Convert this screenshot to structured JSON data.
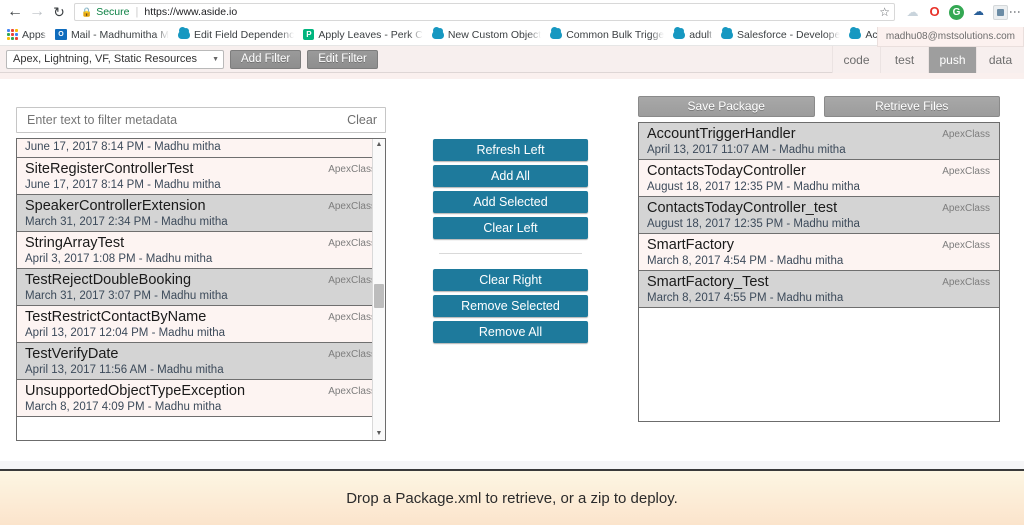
{
  "browser": {
    "back_icon": "back-arrow-icon",
    "forward_icon": "forward-arrow-icon",
    "reload_icon": "reload-icon",
    "security_label": "Secure",
    "url": "https://www.aside.io",
    "bookmark_star": "☆",
    "menu_icon": "kebab-menu-icon",
    "extensions": [
      {
        "name": "cloud-extension-icon",
        "glyph": "☁"
      },
      {
        "name": "opera-extension-icon",
        "glyph": "O"
      },
      {
        "name": "grammarly-extension-icon",
        "glyph": "G"
      },
      {
        "name": "blue-extension-icon",
        "glyph": "☁"
      },
      {
        "name": "square-extension-icon",
        "glyph": ""
      }
    ],
    "bookmarks": [
      {
        "label": "Apps",
        "icon": "apps-grid-icon"
      },
      {
        "label": "Mail - Madhumitha M",
        "icon": "outlook-icon"
      },
      {
        "label": "Edit Field Dependenc",
        "icon": "salesforce-cloud-icon"
      },
      {
        "label": "Apply Leaves - Perk C",
        "icon": "perk-icon"
      },
      {
        "label": "New Custom Object",
        "icon": "salesforce-cloud-icon"
      },
      {
        "label": "Common Bulk Trigge",
        "icon": "salesforce-cloud-icon"
      },
      {
        "label": "adult",
        "icon": "salesforce-cloud-icon"
      },
      {
        "label": "Salesforce - Develope",
        "icon": "salesforce-cloud-icon"
      },
      {
        "label": "Account Fields – Sale",
        "icon": "salesforce-cloud-icon"
      },
      {
        "label": "",
        "icon": "salesforce-cloud-icon"
      },
      {
        "label": "",
        "icon": "salesforce-cloud-icon"
      }
    ],
    "bookmarks_overflow": "»"
  },
  "toolbar": {
    "metadata_filter_value": "Apex, Lightning, VF, Static Resources",
    "caret_icon": "chevron-down-icon",
    "add_filter_label": "Add Filter",
    "edit_filter_label": "Edit Filter",
    "tabs": [
      {
        "label": "code",
        "active": false
      },
      {
        "label": "test",
        "active": false
      },
      {
        "label": "push",
        "active": true
      },
      {
        "label": "data",
        "active": false
      }
    ],
    "user_email": "madhu08@mstsolutions.com"
  },
  "left_panel": {
    "filter_placeholder": "Enter text to filter metadata",
    "filter_value": "",
    "clear_label": "Clear",
    "scroll_up_icon": "▲",
    "scroll_down_icon": "▼",
    "items": [
      {
        "name": "",
        "sub": "June 17, 2017 8:14 PM - Madhu mitha",
        "type": "",
        "clipped": true
      },
      {
        "name": "SiteRegisterControllerTest",
        "sub": "June 17, 2017 8:14 PM - Madhu mitha",
        "type": "ApexClass"
      },
      {
        "name": "SpeakerControllerExtension",
        "sub": "March 31, 2017 2:34 PM - Madhu mitha",
        "type": "ApexClass"
      },
      {
        "name": "StringArrayTest",
        "sub": "April 3, 2017 1:08 PM - Madhu mitha",
        "type": "ApexClass"
      },
      {
        "name": "TestRejectDoubleBooking",
        "sub": "March 31, 2017 3:07 PM - Madhu mitha",
        "type": "ApexClass"
      },
      {
        "name": "TestRestrictContactByName",
        "sub": "April 13, 2017 12:04 PM - Madhu mitha",
        "type": "ApexClass"
      },
      {
        "name": "TestVerifyDate",
        "sub": "April 13, 2017 11:56 AM - Madhu mitha",
        "type": "ApexClass"
      },
      {
        "name": "UnsupportedObjectTypeException",
        "sub": "March 8, 2017 4:09 PM - Madhu mitha",
        "type": "ApexClass"
      }
    ]
  },
  "mid_buttons": {
    "top": [
      "Refresh Left",
      "Add All",
      "Add Selected",
      "Clear Left"
    ],
    "bottom": [
      "Clear Right",
      "Remove Selected",
      "Remove All"
    ]
  },
  "right_panel": {
    "save_package_label": "Save Package",
    "retrieve_files_label": "Retrieve Files",
    "items": [
      {
        "name": "AccountTriggerHandler",
        "sub": "April 13, 2017 11:07 AM - Madhu mitha",
        "type": "ApexClass"
      },
      {
        "name": "ContactsTodayController",
        "sub": "August 18, 2017 12:35 PM - Madhu mitha",
        "type": "ApexClass"
      },
      {
        "name": "ContactsTodayController_test",
        "sub": "August 18, 2017 12:35 PM - Madhu mitha",
        "type": "ApexClass"
      },
      {
        "name": "SmartFactory",
        "sub": "March 8, 2017 4:54 PM - Madhu mitha",
        "type": "ApexClass"
      },
      {
        "name": "SmartFactory_Test",
        "sub": "March 8, 2017 4:55 PM - Madhu mitha",
        "type": "ApexClass"
      }
    ]
  },
  "dropzone": {
    "message": "Drop a Package.xml to retrieve, or a zip to deploy."
  },
  "colors": {
    "accent_teal": "#1e7a9c",
    "toolbar_pink": "#f7efee",
    "row_alt": "#d4d4d4",
    "dropzone_start": "#fdf6e3",
    "dropzone_end": "#fbe4cc"
  }
}
